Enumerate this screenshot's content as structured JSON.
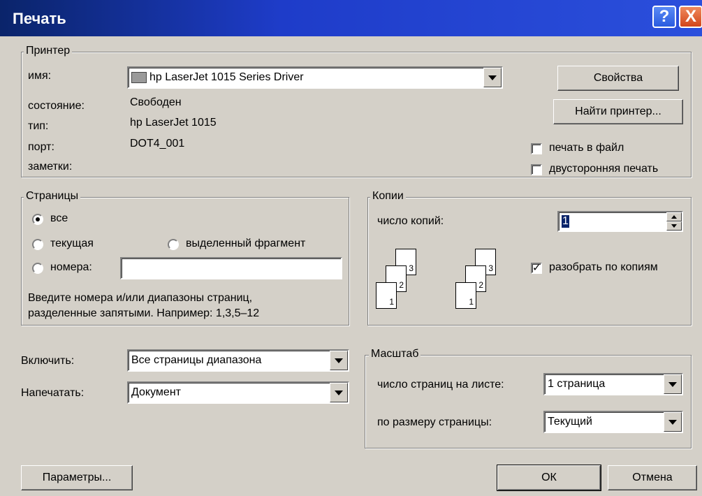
{
  "window": {
    "title": "Печать",
    "help": "?",
    "close": "X"
  },
  "printer": {
    "group": "Принтер",
    "name_label": "имя:",
    "name_value": "hp LaserJet 1015 Series Driver",
    "state_label": "состояние:",
    "state_value": "Свободен",
    "type_label": "тип:",
    "type_value": "hp LaserJet 1015",
    "port_label": "порт:",
    "port_value": "DOT4_001",
    "notes_label": "заметки:",
    "properties": "Свойства",
    "find": "Найти принтер...",
    "print_to_file": "печать в файл",
    "duplex": "двусторонняя печать"
  },
  "pages": {
    "group": "Страницы",
    "all": "все",
    "current": "текущая",
    "selection": "выделенный фрагмент",
    "numbers": "номера:",
    "numbers_value": "",
    "hint1": "Введите номера и/или диапазоны страниц,",
    "hint2": "разделенные запятыми. Например: 1,3,5–12"
  },
  "copies": {
    "group": "Копии",
    "count_label": "число копий:",
    "count_value": "1",
    "collate": "разобрать по копиям",
    "collate_checked": true,
    "page_numbers": [
      "3",
      "2",
      "1"
    ]
  },
  "include": {
    "label": "Включить:",
    "value": "Все страницы диапазона"
  },
  "print_what": {
    "label": "Напечатать:",
    "value": "Документ"
  },
  "zoom": {
    "group": "Масштаб",
    "per_sheet_label": "число страниц на листе:",
    "per_sheet_value": "1 страница",
    "scale_label": "по размеру страницы:",
    "scale_value": "Текущий"
  },
  "buttons": {
    "options": "Параметры...",
    "ok": "ОК",
    "cancel": "Отмена"
  }
}
